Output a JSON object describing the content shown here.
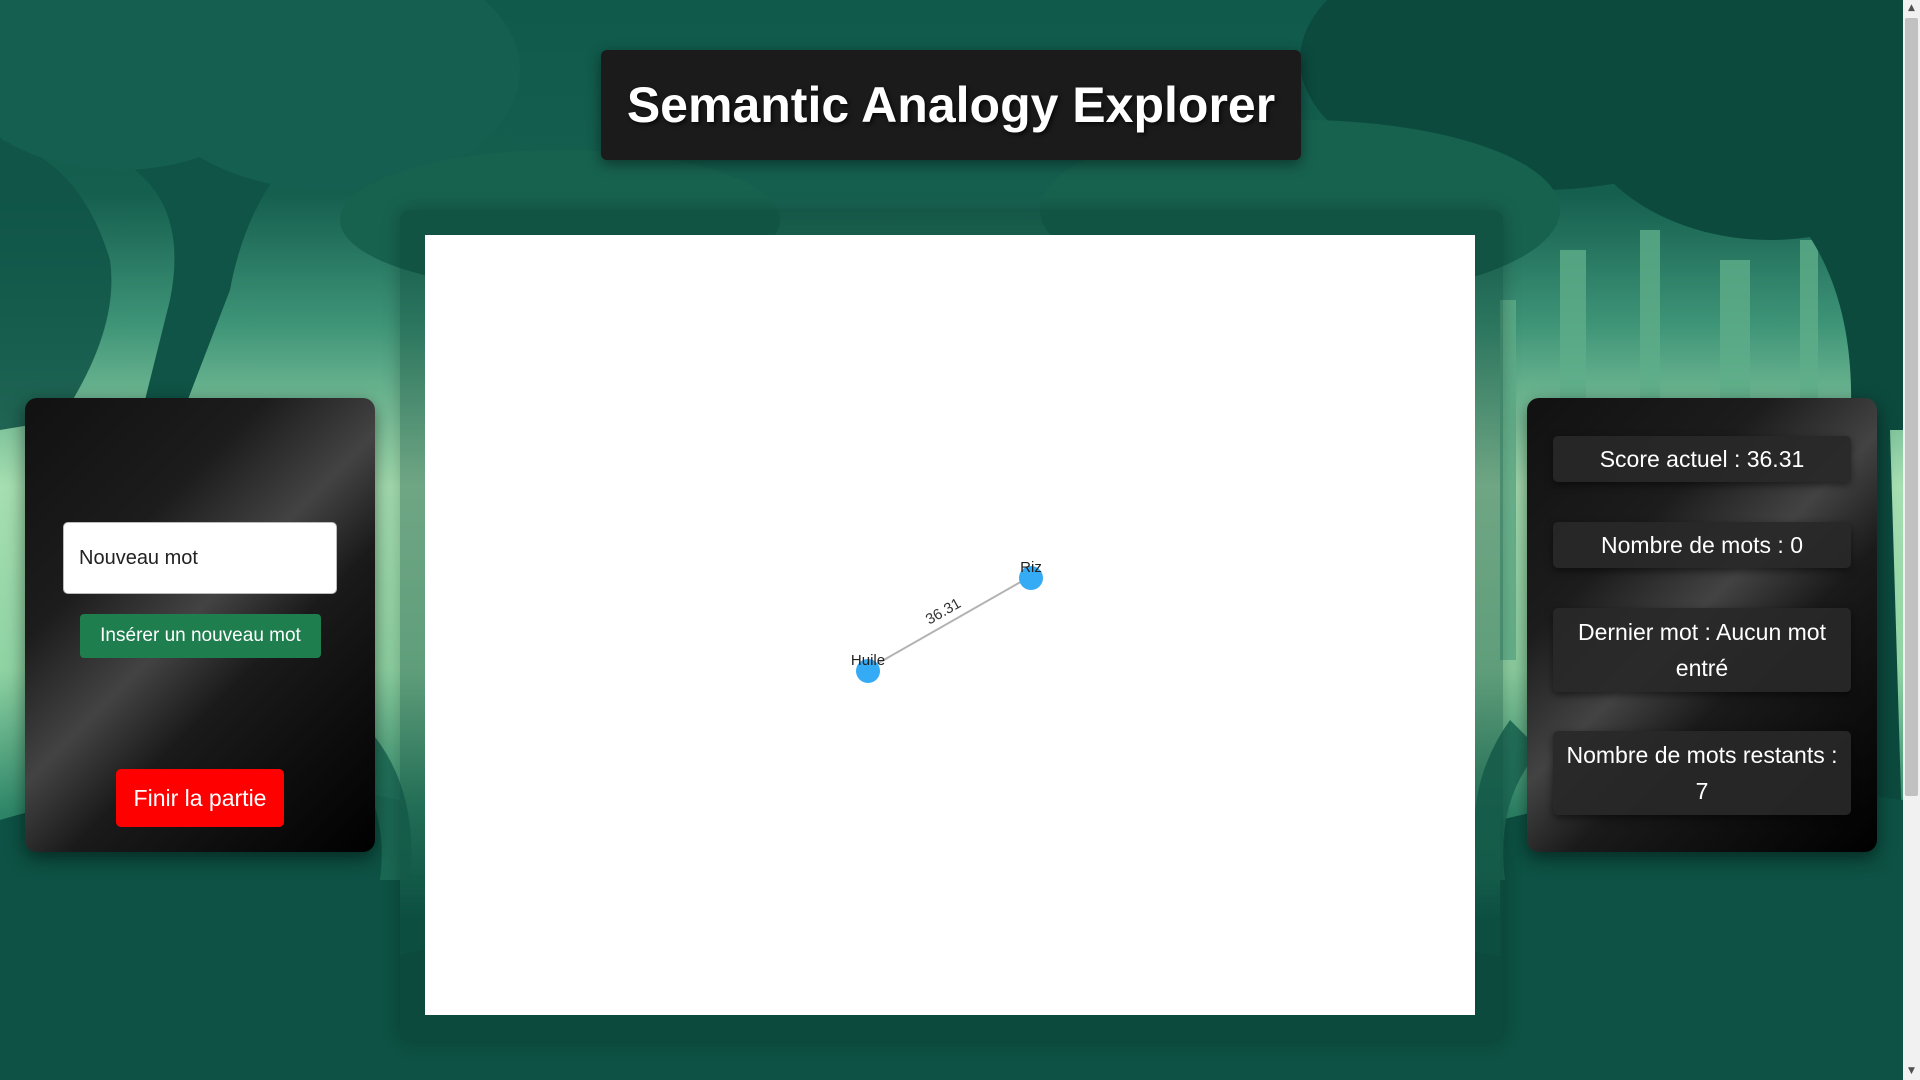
{
  "header": {
    "title": "Semantic Analogy Explorer"
  },
  "controls": {
    "input_placeholder": "Nouveau mot",
    "insert_label": "Insérer un nouveau mot",
    "end_label": "Finir la partie"
  },
  "stats": {
    "score": "Score actuel : 36.31",
    "word_count": "Nombre de mots : 0",
    "last_word": "Dernier mot : Aucun mot entré",
    "remaining": "Nombre de mots restants : 7"
  },
  "graph": {
    "nodes": [
      {
        "id": "huile",
        "label": "Huile"
      },
      {
        "id": "riz",
        "label": "Riz"
      }
    ],
    "edges": [
      {
        "from": "huile",
        "to": "riz",
        "label": "36.31"
      }
    ]
  },
  "colors": {
    "node": "#35aaf5",
    "edge": "#b3b3b3",
    "insert_button": "#1e7e4e",
    "end_button": "#ff0000"
  },
  "icons": {
    "scroll_up": "▲",
    "scroll_down": "▼"
  }
}
